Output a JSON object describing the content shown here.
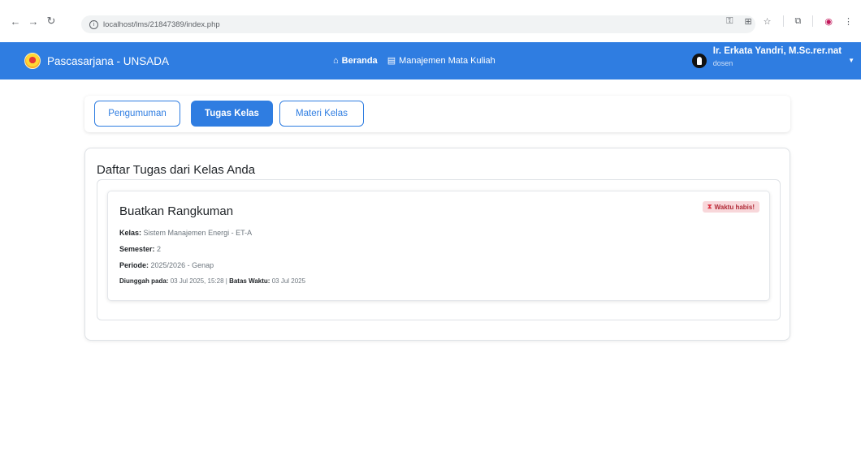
{
  "browser": {
    "url": "localhost/lms/21847389/index.php"
  },
  "navbar": {
    "brand": "Pascasarjana - UNSADA",
    "links": [
      {
        "label": "Beranda",
        "icon": "home-icon"
      },
      {
        "label": "Manajemen Mata Kuliah",
        "icon": "calendar-icon"
      }
    ],
    "user_name": "Ir. Erkata Yandri, M.Sc.rer.nat",
    "user_role": "dosen",
    "accent_color": "#2f7de1"
  },
  "tabs": [
    {
      "label": "Pengumuman",
      "active": false
    },
    {
      "label": "Tugas Kelas",
      "active": true
    },
    {
      "label": "Materi Kelas",
      "active": false
    }
  ],
  "main": {
    "title": "Daftar Tugas dari Kelas Anda",
    "task": {
      "title": "Buatkan Rangkuman",
      "badge": "Waktu habis!",
      "kelas_label": "Kelas:",
      "kelas_value": "Sistem Manajemen Energi - ET-A",
      "semester_label": "Semester:",
      "semester_value": "2",
      "periode_label": "Periode:",
      "periode_value": "2025/2026 - Genap",
      "diunggah_label": "Diunggah pada:",
      "diunggah_value": "03 Jul 2025, 15:28",
      "separator": "|",
      "batas_label": "Batas Waktu:",
      "batas_value": "03 Jul 2025"
    }
  }
}
